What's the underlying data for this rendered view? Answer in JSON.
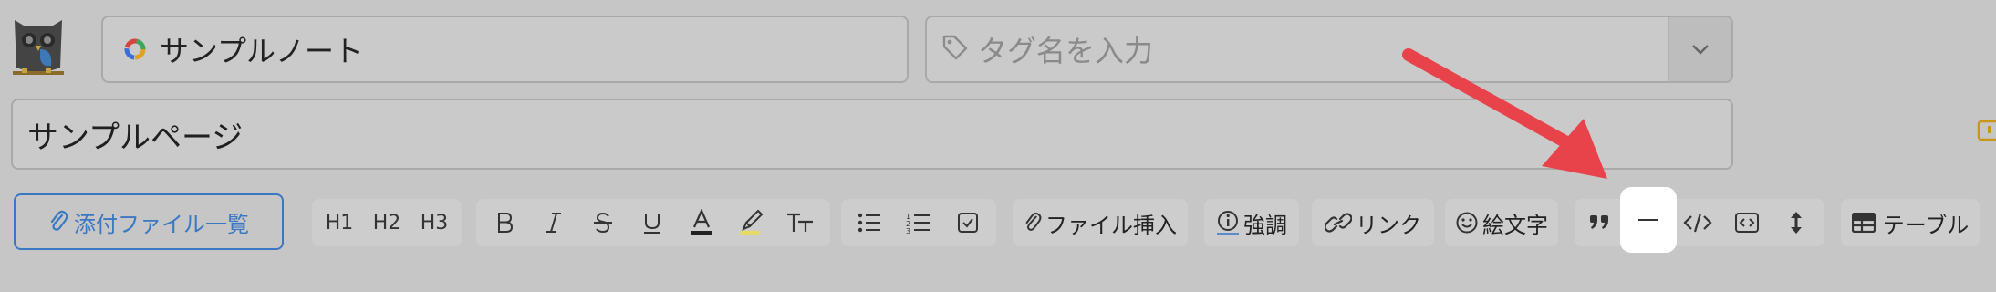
{
  "header": {
    "notebook": {
      "name": "サンプルノート"
    },
    "tag_input": {
      "placeholder": "タグ名を入力"
    },
    "page_title": "サンプルページ"
  },
  "toolbar": {
    "attachments_label": "添付ファイル一覧",
    "headings": [
      "H1",
      "H2",
      "H3"
    ],
    "formatting": [
      "bold",
      "italic",
      "strikethrough",
      "underline",
      "font-color",
      "highlight",
      "text-size"
    ],
    "lists": [
      "bulleted-list",
      "numbered-list",
      "checklist"
    ],
    "file_insert_label": "ファイル挿入",
    "emphasis_label": "強調",
    "link_label": "リンク",
    "emoji_label": "絵文字",
    "insert_tools": [
      "quote",
      "horizontal-rule",
      "code",
      "code-block",
      "line-height"
    ],
    "table_label": "テーブル"
  },
  "annotation": {
    "arrow_color": "#e8434a",
    "highlighted_tool": "horizontal-rule"
  },
  "colors": {
    "background": "#c6c6c6",
    "accent_blue": "#3a78c3",
    "field_border": "#a9a9a9",
    "highlight_box": "#ffffff"
  }
}
